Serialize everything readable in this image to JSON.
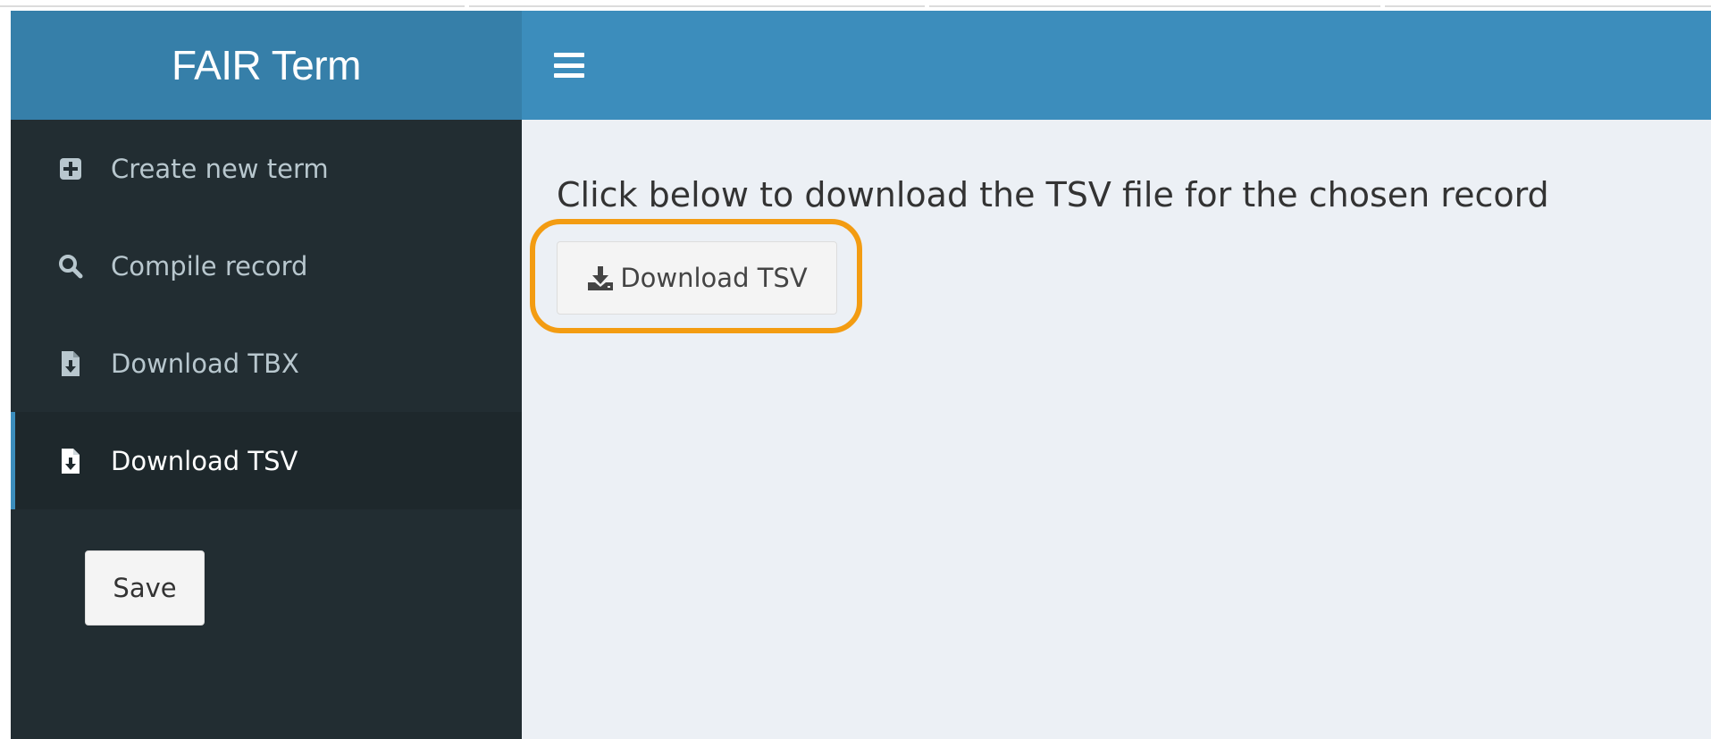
{
  "app": {
    "title": "FAIR Term"
  },
  "header": {
    "menu_toggle_icon": "hamburger-icon"
  },
  "sidebar": {
    "items": [
      {
        "label": "Create new term",
        "icon": "plus-square-icon",
        "active": false
      },
      {
        "label": "Compile record",
        "icon": "search-icon",
        "active": false
      },
      {
        "label": "Download TBX",
        "icon": "file-download-icon",
        "active": false
      },
      {
        "label": "Download TSV",
        "icon": "file-download-icon",
        "active": true
      }
    ],
    "save_label": "Save"
  },
  "main": {
    "instruction": "Click below to download the TSV file for the chosen record",
    "download_button_label": "Download TSV",
    "download_button_icon": "download-icon"
  },
  "colors": {
    "logo_bg": "#367fa9",
    "navbar_bg": "#3c8dbc",
    "sidebar_bg": "#222d32",
    "sidebar_active_bg": "#1e282c",
    "content_bg": "#ecf0f5",
    "highlight": "#f39c12"
  }
}
